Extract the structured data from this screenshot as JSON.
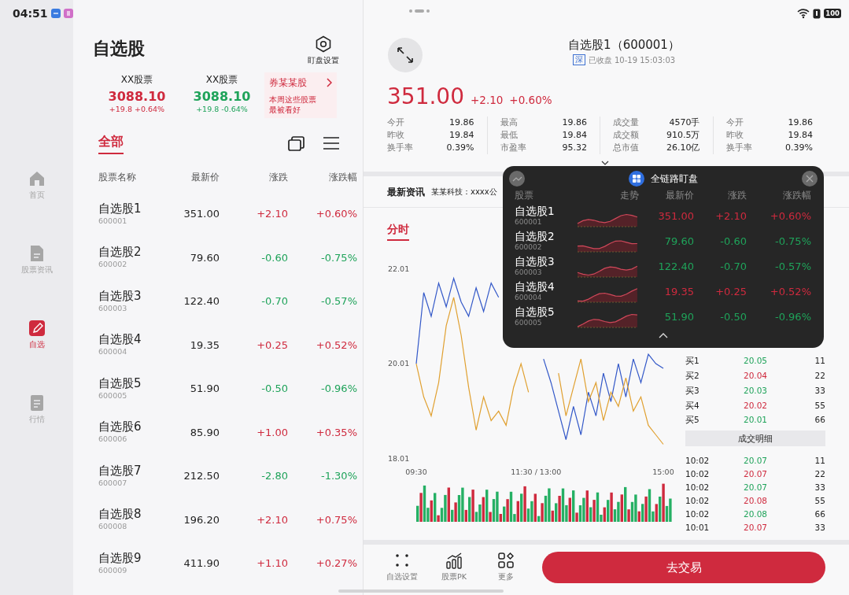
{
  "status_bar": {
    "time": "04:51",
    "battery": "100"
  },
  "nav": [
    {
      "label": "首页",
      "kind": "home",
      "selected": false
    },
    {
      "label": "股票资讯",
      "kind": "news",
      "selected": false
    },
    {
      "label": "自选",
      "kind": "watch",
      "selected": true
    },
    {
      "label": "行情",
      "kind": "market",
      "selected": false
    }
  ],
  "watchlist": {
    "title": "自选股",
    "settings_label": "盯盘设置",
    "indices": [
      {
        "name": "XX股票",
        "value": "3088.10",
        "change": "+19.8 +0.64%",
        "kind": "rise"
      },
      {
        "name": "XX股票",
        "value": "3088.10",
        "change": "+19.8 -0.64%",
        "kind": "fall"
      }
    ],
    "promo": {
      "title": "券某某股",
      "text": "本周这些股票最被看好"
    },
    "tabs": [
      {
        "label": "全部",
        "selected": true
      }
    ],
    "columns": [
      "股票名称",
      "最新价",
      "涨跌",
      "涨跌幅"
    ],
    "rows": [
      {
        "name": "自选股1",
        "code": "600001",
        "price": "351.00",
        "change": "+2.10",
        "pct": "+0.60%",
        "kind": "rise"
      },
      {
        "name": "自选股2",
        "code": "600002",
        "price": "79.60",
        "change": "-0.60",
        "pct": "-0.75%",
        "kind": "fall"
      },
      {
        "name": "自选股3",
        "code": "600003",
        "price": "122.40",
        "change": "-0.70",
        "pct": "-0.57%",
        "kind": "fall"
      },
      {
        "name": "自选股4",
        "code": "600004",
        "price": "19.35",
        "change": "+0.25",
        "pct": "+0.52%",
        "kind": "rise"
      },
      {
        "name": "自选股5",
        "code": "600005",
        "price": "51.90",
        "change": "-0.50",
        "pct": "-0.96%",
        "kind": "fall"
      },
      {
        "name": "自选股6",
        "code": "600006",
        "price": "85.90",
        "change": "+1.00",
        "pct": "+0.35%",
        "kind": "rise"
      },
      {
        "name": "自选股7",
        "code": "600007",
        "price": "212.50",
        "change": "-2.80",
        "pct": "-1.30%",
        "kind": "fall"
      },
      {
        "name": "自选股8",
        "code": "600008",
        "price": "196.20",
        "change": "+2.10",
        "pct": "+0.75%",
        "kind": "rise"
      },
      {
        "name": "自选股9",
        "code": "600009",
        "price": "411.90",
        "change": "+1.10",
        "pct": "+0.27%",
        "kind": "rise"
      }
    ]
  },
  "detail": {
    "title": "自选股1（600001）",
    "exchange": "深",
    "status": "已收盘 10-19 15:03:03",
    "price": "351.00",
    "change": "+2.10",
    "pct": "+0.60%",
    "kind": "rise",
    "stats": [
      [
        {
          "label": "今开",
          "value": "19.86"
        },
        {
          "label": "昨收",
          "value": "19.84"
        },
        {
          "label": "换手率",
          "value": "0.39%"
        }
      ],
      [
        {
          "label": "最高",
          "value": "19.86"
        },
        {
          "label": "最低",
          "value": "19.84"
        },
        {
          "label": "市盈率",
          "value": "95.32"
        }
      ],
      [
        {
          "label": "成交量",
          "value": "4570手"
        },
        {
          "label": "成交额",
          "value": "910.5万"
        },
        {
          "label": "总市值",
          "value": "26.10亿"
        }
      ],
      [
        {
          "label": "今开",
          "value": "19.86"
        },
        {
          "label": "昨收",
          "value": "19.84"
        },
        {
          "label": "换手率",
          "value": "0.39%"
        }
      ]
    ],
    "news": {
      "label": "最新资讯",
      "text": "某某科技：xxxx公"
    },
    "tabs": [
      {
        "label": "分时",
        "selected": true
      }
    ],
    "chart_data": {
      "type": "line",
      "ylim": [
        18.01,
        22.01
      ],
      "yticks": [
        18.01,
        20.01,
        22.01
      ],
      "categories": [
        "09:30",
        null,
        null,
        null,
        null,
        null,
        null,
        null,
        null,
        null,
        null,
        null,
        null,
        null,
        null,
        null,
        "11:30 / 13:00",
        null,
        null,
        null,
        null,
        null,
        null,
        null,
        null,
        null,
        null,
        null,
        null,
        null,
        null,
        null,
        null,
        "15:00"
      ],
      "series": [
        {
          "color": "#3358c8",
          "values": [
            20.0,
            21.5,
            21.0,
            21.7,
            21.2,
            21.8,
            21.3,
            21.0,
            21.6,
            21.1,
            21.7,
            21.4,
            null,
            null,
            null,
            null,
            null,
            20.1,
            19.6,
            19.0,
            18.4,
            19.1,
            18.5,
            19.4,
            18.9,
            19.8,
            19.2,
            20.0,
            19.3,
            20.1,
            19.6,
            20.2,
            20.0,
            19.9
          ]
        },
        {
          "color": "#e0a030",
          "values": [
            20.0,
            19.3,
            18.9,
            19.6,
            20.8,
            21.4,
            20.6,
            19.5,
            18.6,
            19.3,
            18.8,
            19.0,
            18.7,
            19.5,
            20.0,
            19.4,
            null,
            null,
            null,
            19.8,
            18.9,
            19.5,
            20.1,
            19.2,
            19.6,
            18.8,
            19.4,
            19.1,
            19.7,
            19.0,
            19.3,
            18.7,
            18.5,
            18.3
          ]
        }
      ]
    },
    "bids": [
      {
        "label": "买1",
        "price": "20.05",
        "volume": "11",
        "kind": "fall"
      },
      {
        "label": "买2",
        "price": "20.04",
        "volume": "22",
        "kind": "rise"
      },
      {
        "label": "买3",
        "price": "20.03",
        "volume": "33",
        "kind": "fall"
      },
      {
        "label": "买4",
        "price": "20.02",
        "volume": "55",
        "kind": "rise"
      },
      {
        "label": "买5",
        "price": "20.01",
        "volume": "66",
        "kind": "fall"
      }
    ],
    "trades_title": "成交明细",
    "trades": [
      {
        "time": "10:02",
        "price": "20.07",
        "volume": "11",
        "kind": "fall"
      },
      {
        "time": "10:02",
        "price": "20.07",
        "volume": "22",
        "kind": "rise"
      },
      {
        "time": "10:02",
        "price": "20.07",
        "volume": "33",
        "kind": "fall"
      },
      {
        "time": "10:02",
        "price": "20.08",
        "volume": "55",
        "kind": "rise"
      },
      {
        "time": "10:02",
        "price": "20.08",
        "volume": "66",
        "kind": "fall"
      },
      {
        "time": "10:01",
        "price": "20.07",
        "volume": "33",
        "kind": "rise"
      }
    ],
    "toolbar": [
      {
        "label": "自选设置",
        "kind": "dots"
      },
      {
        "label": "股票PK",
        "kind": "chart"
      },
      {
        "label": "更多",
        "kind": "grid"
      }
    ],
    "trade_button": "去交易"
  },
  "monitor": {
    "title": "全链路盯盘",
    "columns": [
      "股票",
      "走势",
      "最新价",
      "涨跌",
      "涨跌幅"
    ],
    "rows": [
      {
        "name": "自选股1",
        "code": "600001",
        "price": "351.00",
        "change": "+2.10",
        "pct": "+0.60%",
        "kind": "rise"
      },
      {
        "name": "自选股2",
        "code": "600002",
        "price": "79.60",
        "change": "-0.60",
        "pct": "-0.75%",
        "kind": "fall"
      },
      {
        "name": "自选股3",
        "code": "600003",
        "price": "122.40",
        "change": "-0.70",
        "pct": "-0.57%",
        "kind": "fall"
      },
      {
        "name": "自选股4",
        "code": "600004",
        "price": "19.35",
        "change": "+0.25",
        "pct": "+0.52%",
        "kind": "rise"
      },
      {
        "name": "自选股5",
        "code": "600005",
        "price": "51.90",
        "change": "-0.50",
        "pct": "-0.96%",
        "kind": "fall"
      }
    ]
  }
}
